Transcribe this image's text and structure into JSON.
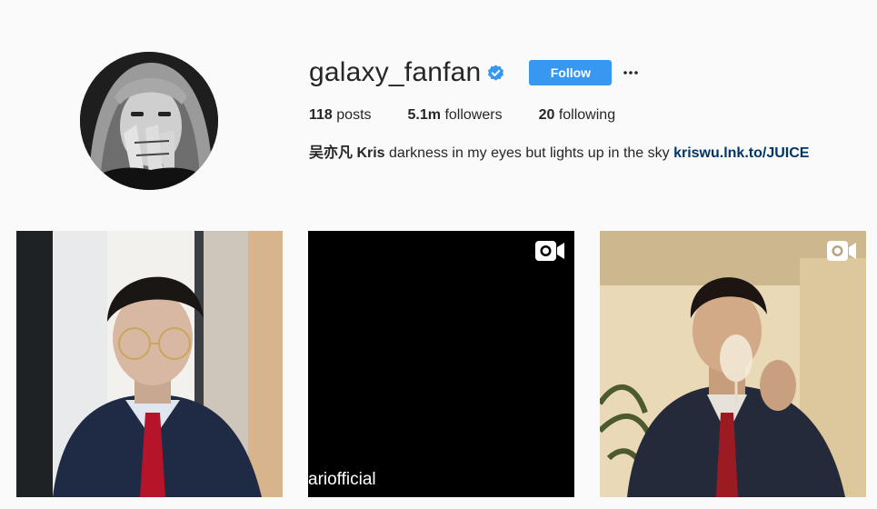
{
  "profile": {
    "username": "galaxy_fanfan",
    "follow_label": "Follow",
    "stats": {
      "posts_count": "118",
      "posts_label": "posts",
      "followers_count": "5.1m",
      "followers_label": "followers",
      "following_count": "20",
      "following_label": "following"
    },
    "bio": {
      "full_name": "吴亦凡 Kris",
      "text": "darkness in my eyes but lights up in the sky",
      "link": "kriswu.lnk.to/JUICE"
    }
  },
  "posts": [
    {
      "type": "photo"
    },
    {
      "type": "video",
      "overlay_text": "ariofficial"
    },
    {
      "type": "video"
    }
  ],
  "colors": {
    "background": "#fafafa",
    "follow_button": "#3897f0",
    "verified_badge": "#3897f0",
    "link": "#003569"
  }
}
